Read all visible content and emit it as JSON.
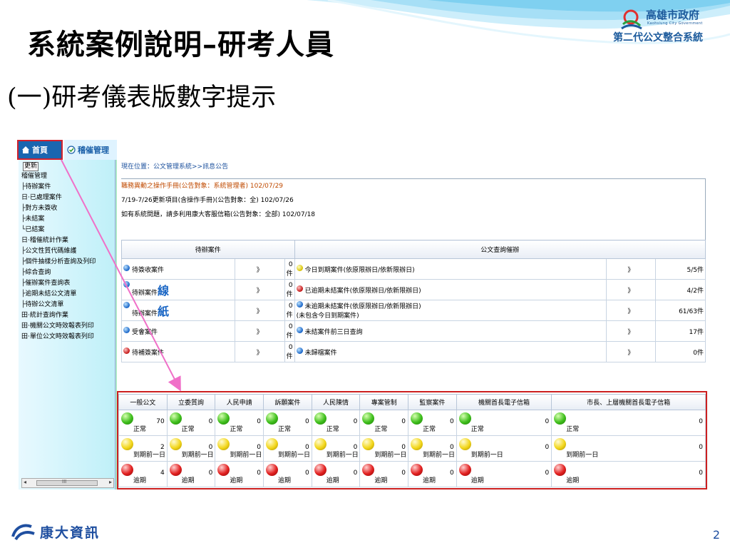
{
  "slide": {
    "title": "系統案例說明–研考人員",
    "subtitle": "(一)研考儀表版數字提示",
    "page_number": "2",
    "footer_brand": "康大資訊"
  },
  "logo": {
    "city": "高雄市政府",
    "city_en": "Kaohsiung City Government",
    "system": "第二代公文整合系統"
  },
  "nav": {
    "home_label": "首頁",
    "audit_label": "稽催管理"
  },
  "sidebar": {
    "refresh_label": "更新",
    "items": [
      {
        "label": "稽催管理"
      },
      {
        "label": "├待辦案件"
      },
      {
        "label": "日·已處理案件"
      },
      {
        "label": "  ├對方未簽收"
      },
      {
        "label": "  ├未結案"
      },
      {
        "label": "  └已結案"
      },
      {
        "label": "日·稽催統計作業"
      },
      {
        "label": "  ├公文性質代碼維護"
      },
      {
        "label": "  ├個件抽樣分析查詢及列印"
      },
      {
        "label": "  ├綜合查詢"
      },
      {
        "label": "  ├催辦案件查詢表"
      },
      {
        "label": "  ├逾期未結公文清單"
      },
      {
        "label": "  ├待辦公文清單"
      },
      {
        "label": "田·統計查詢作業"
      },
      {
        "label": "田·機關公文時效報表列印"
      },
      {
        "label": "田·單位公文時效報表列印"
      }
    ],
    "scroll_grip": "III"
  },
  "content": {
    "location": "現在位置：公文管理系統>>訊息公告",
    "announcements": [
      "職務異動之操作手冊(公告對象：系統管理者) 102/07/29",
      "7/19-7/26更新項目(含操作手冊)(公告對象：全) 102/07/26",
      "如有系統問題，請多利用康大客服信箱(公告對象：全部) 102/07/18"
    ]
  },
  "todo": {
    "header_left": "待辦案件",
    "header_right": "公文查詢催辦",
    "rows": [
      {
        "left_dot": "blue",
        "left_label": "待簽收案件",
        "left_big": "",
        "left_arrow": "》",
        "left_count": "0件",
        "right_dot": "yellow",
        "right_label": "今日到期案件(依原限辦日/依新限辦日)",
        "right_label2": "",
        "right_arrow": "》",
        "right_count": "5/5件"
      },
      {
        "left_dot": "blue",
        "left_label": "待辦案件",
        "left_big": "線",
        "left_arrow": "》",
        "left_count": "0件",
        "right_dot": "red",
        "right_label": "已逾期未結案件(依原限辦日/依新限辦日)",
        "right_label2": "",
        "right_arrow": "》",
        "right_count": "4/2件"
      },
      {
        "left_dot": "blue",
        "left_label": "待辦案件",
        "left_big": "紙",
        "left_arrow": "》",
        "left_count": "0件",
        "right_dot": "blue",
        "right_label": "未逾期未結案件(依原限辦日/依新限辦日)",
        "right_label2": "(未包含今日到期案件)",
        "right_arrow": "》",
        "right_count": "61/63件"
      },
      {
        "left_dot": "blue",
        "left_label": "受會案件",
        "left_big": "",
        "left_arrow": "》",
        "left_count": "0件",
        "right_dot": "blue",
        "right_label": "未結案件前三日查詢",
        "right_label2": "",
        "right_arrow": "》",
        "right_count": "17件"
      },
      {
        "left_dot": "red",
        "left_label": "待補簽案件",
        "left_big": "",
        "left_arrow": "》",
        "left_count": "0件",
        "right_dot": "blue",
        "right_label": "未歸檔案件",
        "right_label2": "",
        "right_arrow": "》",
        "right_count": "0件"
      }
    ]
  },
  "status": {
    "columns": [
      "一般公文",
      "立委質詢",
      "人民申請",
      "訴願案件",
      "人民陳情",
      "專案管制",
      "監察案件",
      "機關首長電子信箱",
      "市長、上層機關首長電子信箱"
    ],
    "rows": [
      {
        "light": "green",
        "label": "正常",
        "counts": [
          "70",
          "0",
          "0",
          "0",
          "0",
          "0",
          "0",
          "0",
          "0"
        ]
      },
      {
        "light": "yellow",
        "label": "到期前一日",
        "counts": [
          "2",
          "0",
          "0",
          "0",
          "0",
          "0",
          "0",
          "0",
          "0"
        ]
      },
      {
        "light": "red",
        "label": "逾期",
        "counts": [
          "4",
          "0",
          "0",
          "0",
          "0",
          "0",
          "0",
          "0",
          "0"
        ]
      }
    ]
  },
  "colors": {
    "title_blue": "#1c5a9c",
    "highlight_red": "#cc2020",
    "arrow_pink": "#f070c8",
    "sidebar_cyan": "#bff0f8"
  }
}
